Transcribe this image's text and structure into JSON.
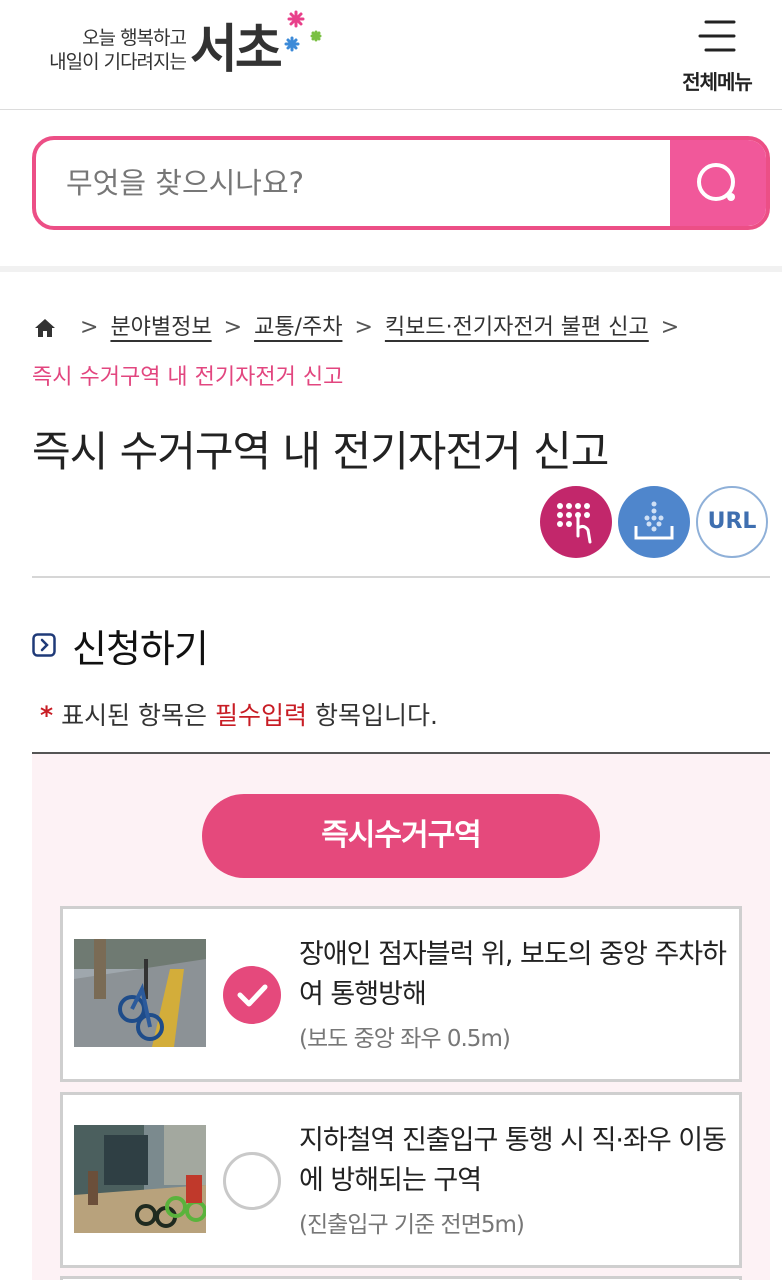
{
  "header": {
    "logo_line1": "오늘 행복하고",
    "logo_line2": "내일이 기다려지는",
    "logo_main": "서초",
    "menu_label": "전체메뉴"
  },
  "search": {
    "placeholder": "무엇을 찾으시나요?"
  },
  "breadcrumb": {
    "items": [
      "분야별정보",
      "교통/주차",
      "킥보드·전기자전거 불편 신고"
    ],
    "current": "즉시 수거구역 내 전기자전거 신고",
    "separator": ">"
  },
  "page": {
    "title": "즉시 수거구역 내 전기자전거 신고",
    "url_button": "URL"
  },
  "section": {
    "heading": "신청하기",
    "required_star": "*",
    "required_prefix": "표시된 항목은 ",
    "required_highlight": "필수입력",
    "required_suffix": " 항목입니다."
  },
  "form": {
    "category_pill": "즉시수거구역",
    "options": [
      {
        "label": "장애인 점자블럭 위, 보도의 중앙 주차하여 통행방해",
        "sub": "(보도 중앙 좌우 0.5m)",
        "checked": true
      },
      {
        "label": "지하철역 진출입구 통행 시 직·좌우 이동에 방해되는 구역",
        "sub": "(진출입구 기준 전면5m)",
        "checked": false
      }
    ]
  },
  "colors": {
    "brand_pink": "#e5497c",
    "search_pink": "#f1589a",
    "required_red": "#c81d25",
    "braille_icon_bg": "#c2276b",
    "download_icon_bg": "#4f86cc",
    "url_icon_border": "#8fb0d8"
  }
}
